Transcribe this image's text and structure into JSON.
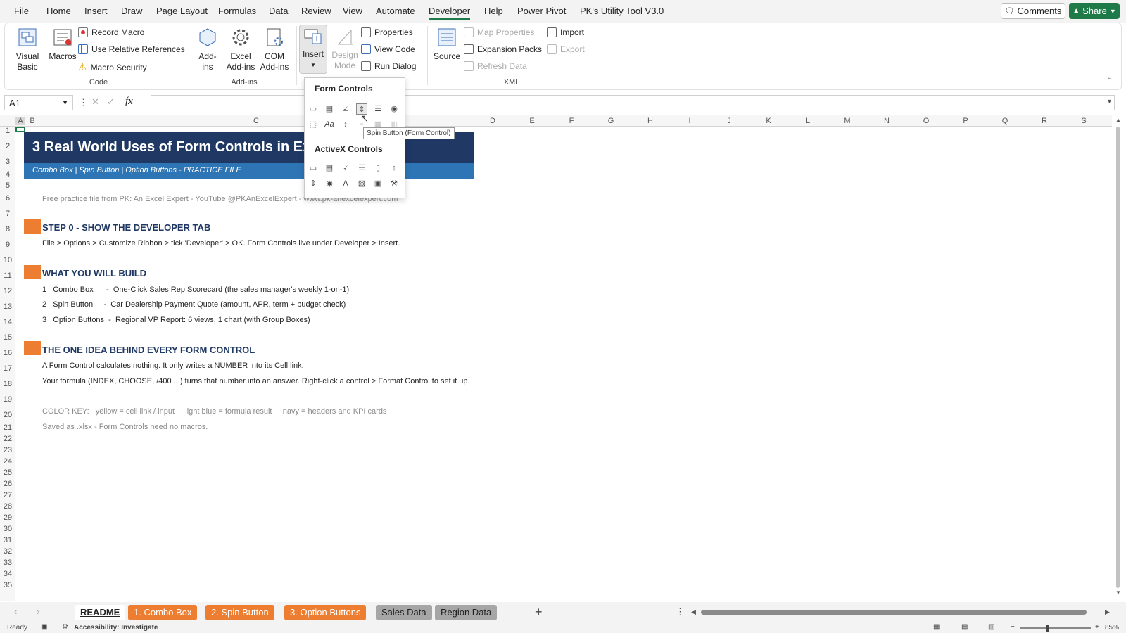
{
  "menu": {
    "tabs": [
      "File",
      "Home",
      "Insert",
      "Draw",
      "Page Layout",
      "Formulas",
      "Data",
      "Review",
      "View",
      "Automate",
      "Developer",
      "Help",
      "Power Pivot",
      "PK's Utility Tool V3.0"
    ],
    "active": "Developer",
    "comments_label": "Comments",
    "share_label": "Share"
  },
  "ribbon": {
    "code": {
      "visual_basic": "Visual Basic",
      "macros": "Macros",
      "record_macro": "Record Macro",
      "use_relative": "Use Relative References",
      "macro_security": "Macro Security",
      "group": "Code"
    },
    "addins": {
      "addins": "Add- ins",
      "excel_addins": "Excel Add-ins",
      "com_addins": "COM Add-ins",
      "group": "Add-ins"
    },
    "controls": {
      "insert": "Insert",
      "design_mode": "Design Mode",
      "properties": "Properties",
      "view_code": "View Code",
      "run_dialog": "Run Dialog"
    },
    "xml": {
      "source": "Source",
      "map_properties": "Map Properties",
      "expansion_packs": "Expansion Packs",
      "refresh_data": "Refresh Data",
      "import": "Import",
      "export": "Export",
      "group": "XML"
    }
  },
  "formula_bar": {
    "name_box": "A1",
    "fx": "fx",
    "value": ""
  },
  "columns": [
    "A",
    "B",
    "C",
    "D",
    "E",
    "F",
    "G",
    "H",
    "I",
    "J",
    "K",
    "L",
    "M",
    "N",
    "O",
    "P",
    "Q",
    "R",
    "S"
  ],
  "rows": [
    "1",
    "2",
    "3",
    "4",
    "5",
    "6",
    "7",
    "8",
    "9",
    "10",
    "11",
    "12",
    "13",
    "14",
    "15",
    "16",
    "17",
    "18",
    "19",
    "20",
    "21",
    "22",
    "23",
    "24",
    "25",
    "26",
    "27",
    "28",
    "29",
    "30",
    "31",
    "32",
    "33",
    "34",
    "35"
  ],
  "sheet": {
    "title": "3 Real World Uses of Form Controls in Ex",
    "subtitle": "Combo Box  |  Spin Button  |  Option Buttons   -   PRACTICE FILE",
    "credit": "Free practice file from PK: An Excel Expert  -  YouTube @PKAnExcelExpert  -  www.pk-anexcelexpert.com",
    "step0_heading": "STEP 0  -  SHOW THE DEVELOPER TAB",
    "step0_text": "File > Options > Customize Ribbon > tick 'Developer' > OK.   Form Controls live under Developer > Insert.",
    "build_heading": "WHAT YOU WILL BUILD",
    "build_items": [
      "1   Combo Box      -  One-Click Sales Rep Scorecard (the sales manager's weekly 1-on-1)",
      "2   Spin Button     -  Car Dealership Payment Quote (amount, APR, term + budget check)",
      "3   Option Buttons  -  Regional VP Report: 6 views, 1 chart (with Group Boxes)"
    ],
    "idea_heading": "THE ONE IDEA BEHIND EVERY FORM CONTROL",
    "idea_line1": "A Form Control calculates nothing. It only writes a NUMBER into its Cell link.",
    "idea_line2": "Your formula (INDEX, CHOOSE, /400 ...) turns that number into an answer. Right-click a control > Format Control to set it up.",
    "color_key": "COLOR KEY:   yellow = cell link / input     light blue = formula result     navy = headers and KPI cards",
    "saved_note": "Saved as .xlsx  -  Form Controls need no macros."
  },
  "dropdown": {
    "form_controls": "Form Controls",
    "activex_controls": "ActiveX Controls",
    "tooltip": "Spin Button (Form Control)",
    "form_row1": [
      "button-icon",
      "combo-box-icon",
      "checkbox-icon",
      "spin-button-icon",
      "list-box-icon",
      "option-button-icon"
    ],
    "form_row2": [
      "group-box-icon",
      "label-icon",
      "scroll-bar-icon",
      "text-field-icon",
      "combo-list-icon",
      "combo-dropdown-icon"
    ],
    "activex_row1": [
      "button-icon",
      "combo-box-icon",
      "checkbox-icon",
      "list-box-icon",
      "text-box-icon",
      "scroll-bar-icon"
    ],
    "activex_row2": [
      "spin-button-icon",
      "option-button-icon",
      "label-icon",
      "image-icon",
      "toggle-button-icon",
      "more-controls-icon"
    ],
    "label_glyph": "Aa",
    "activex_label_glyph": "A"
  },
  "sheet_tabs": [
    {
      "label": "README",
      "style": "active"
    },
    {
      "label": "1. Combo Box",
      "style": "orange"
    },
    {
      "label": "2. Spin Button",
      "style": "orange"
    },
    {
      "label": "3. Option Buttons",
      "style": "orange"
    },
    {
      "label": "Sales Data",
      "style": "gray"
    },
    {
      "label": "Region Data",
      "style": "gray"
    }
  ],
  "status": {
    "ready": "Ready",
    "accessibility": "Accessibility: Investigate",
    "zoom": "85%"
  },
  "colors": {
    "navy": "#1f3864",
    "blue_band": "#2e75b6",
    "orange": "#ed7d31",
    "accent_green": "#1f7a4a"
  }
}
